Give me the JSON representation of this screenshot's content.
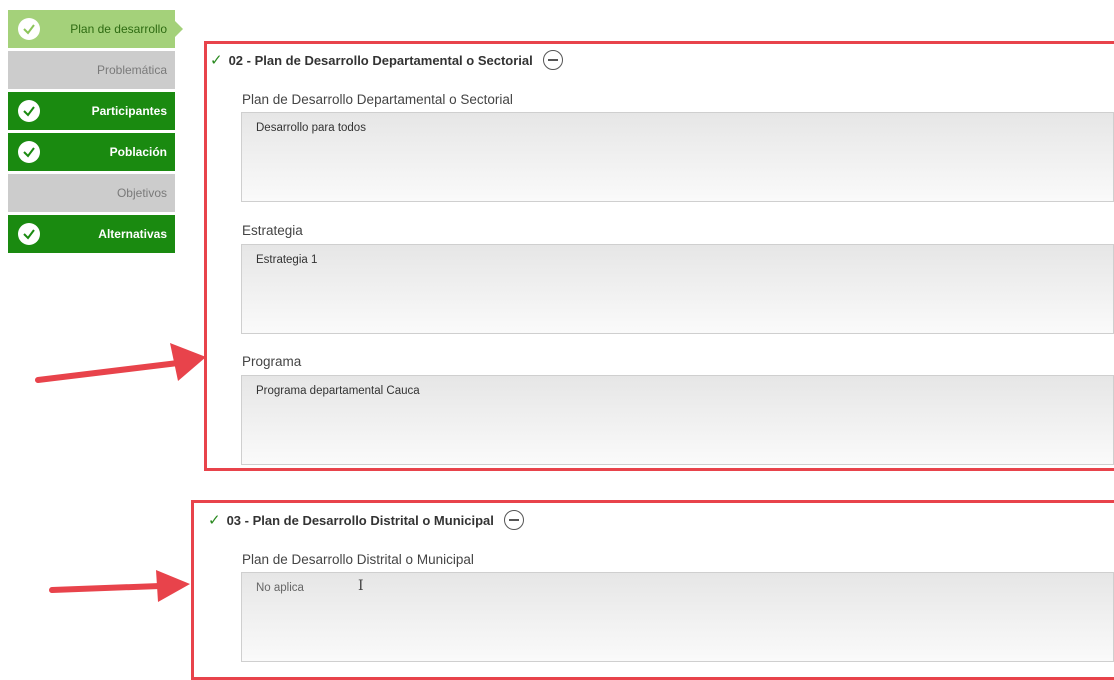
{
  "sidebar": {
    "items": [
      {
        "label": "Plan de desarrollo",
        "state": "current",
        "checked": true
      },
      {
        "label": "Problemática",
        "state": "todo",
        "checked": false
      },
      {
        "label": "Participantes",
        "state": "done",
        "checked": true
      },
      {
        "label": "Población",
        "state": "done",
        "checked": true
      },
      {
        "label": "Objetivos",
        "state": "todo",
        "checked": false
      },
      {
        "label": "Alternativas",
        "state": "done",
        "checked": true
      }
    ]
  },
  "section1": {
    "title": "02 - Plan de Desarrollo Departamental o Sectorial",
    "fields": [
      {
        "label": "Plan de Desarrollo Departamental o Sectorial",
        "value": "Desarrollo para todos"
      },
      {
        "label": "Estrategia",
        "value": "Estrategia 1"
      },
      {
        "label": "Programa",
        "value": "Programa departamental Cauca"
      }
    ]
  },
  "section2": {
    "title": "03 - Plan de Desarrollo Distrital o Municipal",
    "fields": [
      {
        "label": "Plan de Desarrollo Distrital o Municipal",
        "value": "No aplica"
      }
    ]
  },
  "colors": {
    "current_step": "#a4d17a",
    "done_step": "#1a8a10",
    "todo_step": "#cccccc",
    "highlight": "#e8434b"
  }
}
